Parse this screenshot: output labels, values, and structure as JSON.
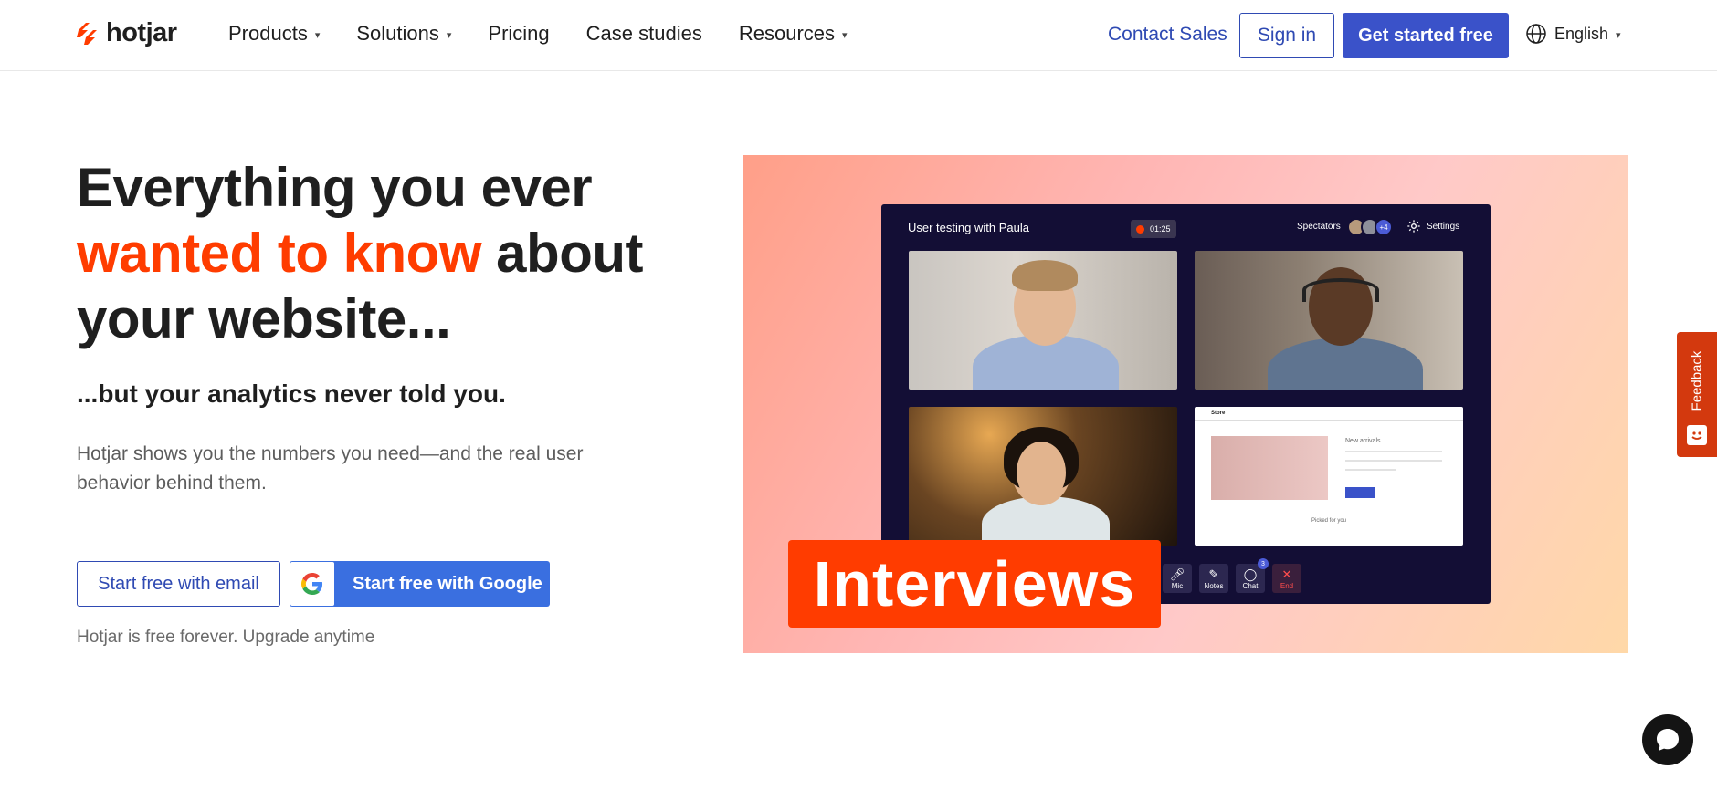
{
  "header": {
    "logo_text": "hotjar",
    "nav": [
      {
        "label": "Products",
        "has_dropdown": true
      },
      {
        "label": "Solutions",
        "has_dropdown": true
      },
      {
        "label": "Pricing",
        "has_dropdown": false
      },
      {
        "label": "Case studies",
        "has_dropdown": false
      },
      {
        "label": "Resources",
        "has_dropdown": true
      }
    ],
    "contact_label": "Contact Sales",
    "signin_label": "Sign in",
    "get_started_label": "Get started free",
    "language": "English"
  },
  "hero": {
    "headline_line1": "Everything you ever",
    "headline_accent": "wanted to know",
    "headline_rest": " about your website...",
    "subhead": "...but your analytics never told you.",
    "description": "Hotjar shows you the numbers you need—and the real user behavior behind them.",
    "email_button": "Start free with email",
    "google_button": "Start free with Google",
    "note": "Hotjar is free forever. Upgrade anytime"
  },
  "hero_image": {
    "window_title": "User testing with Paula",
    "timer": "01:25",
    "spectators_label": "Spectators",
    "spectators_extra": "+4",
    "settings_label": "Settings",
    "store_label": "Store",
    "new_arrivals": "New arrivals",
    "picked_for_you": "Picked for you",
    "controls": [
      {
        "label": "Mic",
        "icon": "mic-icon"
      },
      {
        "label": "Notes",
        "icon": "pencil-icon"
      },
      {
        "label": "Chat",
        "icon": "chat-icon",
        "badge": "3"
      },
      {
        "label": "End",
        "icon": "close-icon"
      }
    ],
    "caption": "Interviews"
  },
  "feedback": {
    "label": "Feedback"
  },
  "colors": {
    "brand_orange": "#ff3c00",
    "primary_blue": "#3a52c9",
    "link_blue": "#2f4ab3",
    "google_blue": "#3a6fe0",
    "feedback_red": "#d3390e"
  }
}
